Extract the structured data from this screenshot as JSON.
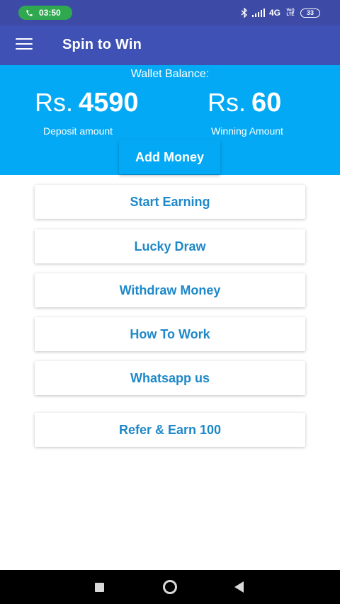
{
  "status_bar": {
    "call_time": "03:50",
    "network": "4G",
    "volte_top": "Vo))",
    "volte_bottom": "LTE",
    "battery": "33"
  },
  "app_bar": {
    "title": "Spin to Win"
  },
  "wallet": {
    "label": "Wallet Balance:",
    "currency": "Rs.",
    "deposit_value": "4590",
    "deposit_label": "Deposit amount",
    "winning_value": "60",
    "winning_label": "Winning Amount",
    "add_money_label": "Add Money"
  },
  "menu": {
    "items": [
      {
        "label": "Start Earning"
      },
      {
        "label": "Lucky Draw"
      },
      {
        "label": "Withdraw Money"
      },
      {
        "label": "How To Work"
      },
      {
        "label": "Whatsapp us"
      },
      {
        "label": "Refer & Earn 100"
      }
    ]
  },
  "colors": {
    "status_bar": "#3d4ba6",
    "app_bar": "#3f51b5",
    "wallet_bg": "#03a9f4",
    "button_text": "#1e88c8",
    "call_pill": "#2fa84f"
  },
  "icons": {
    "call": "phone-icon",
    "bluetooth": "bluetooth-icon",
    "signal": "signal-icon",
    "battery": "battery-icon",
    "menu": "hamburger-menu-icon",
    "nav_recent": "recent-apps-icon",
    "nav_home": "home-icon",
    "nav_back": "back-icon"
  }
}
